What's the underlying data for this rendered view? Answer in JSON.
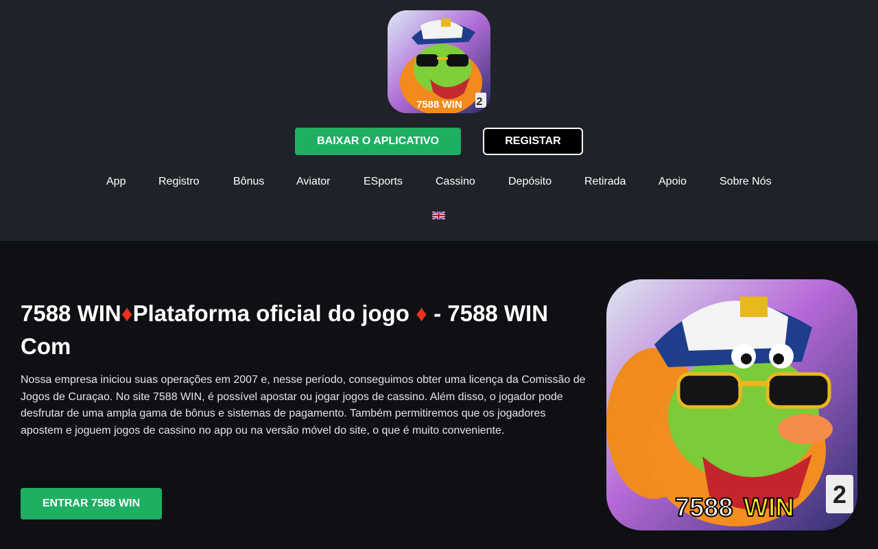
{
  "header": {
    "logo_icon": "dragon-mascot-logo",
    "logo_text": "7588 WIN",
    "download_label": "BAIXAR O APLICATIVO",
    "register_label": "REGISTAR",
    "language_icon": "uk-flag-icon"
  },
  "nav": {
    "items": [
      "App",
      "Registro",
      "Bônus",
      "Aviator",
      "ESports",
      "Cassino",
      "Depósito",
      "Retirada",
      "Apoio",
      "Sobre Nós"
    ]
  },
  "hero": {
    "title_part1": "7588 WIN",
    "title_part2": "Plataforma oficial do jogo ",
    "title_part3": " - 7588 WIN Com",
    "diamond": "♦",
    "paragraph": "Nossa empresa iniciou suas operações em 2007 e, nesse período, conseguimos obter uma licença da Comissão de Jogos de Curaçao. No site 7588 WIN, é possível apostar ou jogar jogos de cassino. Além disso, o jogador pode desfrutar de uma ampla gama de bônus e sistemas de pagamento. Também permitiremos que os jogadores apostem e joguem jogos de cassino no app ou na versão móvel do site, o que é muito conveniente.",
    "enter_label": "ENTRAR 7588 WIN",
    "image_icon": "dragon-mascot-image",
    "image_text_a": "7588",
    "image_text_b": "WIN"
  },
  "colors": {
    "header_bg": "#1f2228",
    "page_bg": "#0e1013",
    "accent_green": "#1eaf63",
    "diamond_red": "#e8321f"
  }
}
